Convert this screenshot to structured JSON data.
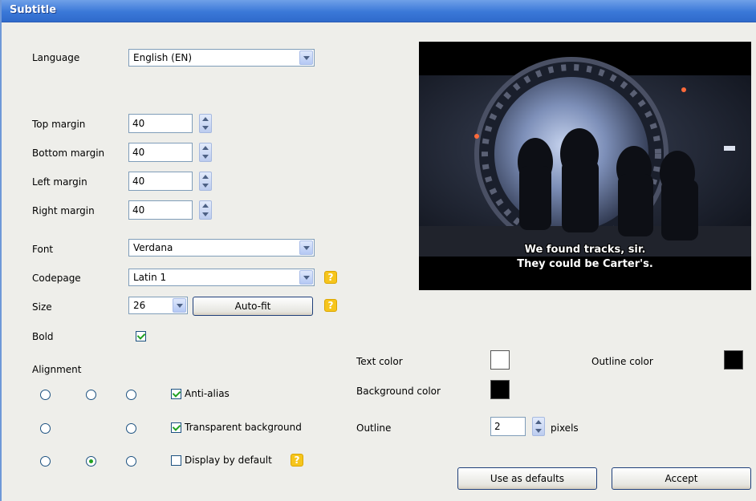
{
  "window": {
    "title": "Subtitle"
  },
  "language": {
    "label": "Language",
    "value": "English (EN)"
  },
  "margins": {
    "top_label": "Top margin",
    "top_value": "40",
    "bottom_label": "Bottom margin",
    "bottom_value": "40",
    "left_label": "Left margin",
    "left_value": "40",
    "right_label": "Right margin",
    "right_value": "40"
  },
  "font": {
    "label": "Font",
    "value": "Verdana"
  },
  "codepage": {
    "label": "Codepage",
    "value": "Latin 1",
    "help": "?"
  },
  "size": {
    "label": "Size",
    "value": "26",
    "autofit_label": "Auto-fit",
    "help": "?"
  },
  "bold": {
    "label": "Bold",
    "checked": true
  },
  "alignment": {
    "label": "Alignment",
    "selected": "bottom-center"
  },
  "options": {
    "antialias_label": "Anti-alias",
    "antialias_checked": true,
    "transparent_label": "Transparent background",
    "transparent_checked": true,
    "display_default_label": "Display by default",
    "display_default_checked": false,
    "display_default_help": "?"
  },
  "preview": {
    "line1": "We found tracks, sir.",
    "line2": "They could be Carter's."
  },
  "colors": {
    "text_label": "Text color",
    "text_value": "#ffffff",
    "outline_label": "Outline color",
    "outline_value": "#000000",
    "background_label": "Background color",
    "background_value": "#000000"
  },
  "outline": {
    "label": "Outline",
    "value": "2",
    "unit": "pixels"
  },
  "buttons": {
    "defaults_label": "Use as defaults",
    "accept_label": "Accept"
  }
}
